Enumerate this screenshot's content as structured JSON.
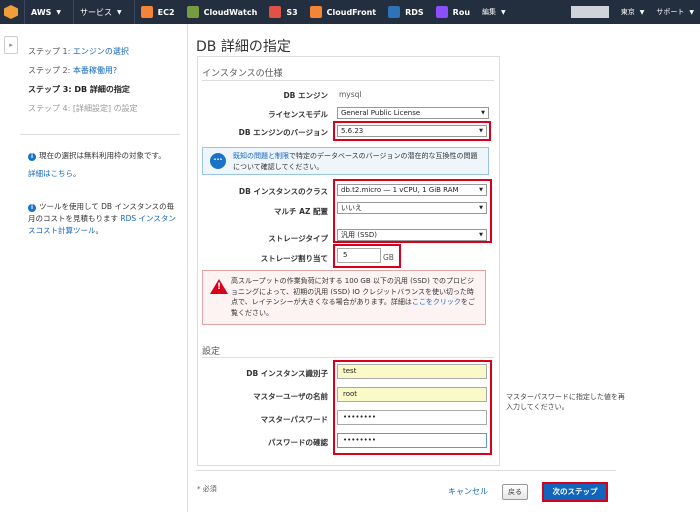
{
  "topbar": {
    "aws": "AWS",
    "services": "サービス",
    "services_ec2": "EC2",
    "services_cloudwatch": "CloudWatch",
    "services_s3": "S3",
    "services_cloudfront": "CloudFront",
    "services_rds": "RDS",
    "services_route": "Rou",
    "edit": "編集",
    "region": "東京",
    "support": "サポート",
    "colors": {
      "bg": "#232f3e",
      "ec2": "#f58536",
      "cw": "#759c3e",
      "s3": "#e05243",
      "cf": "#f58536",
      "rds": "#2e73b8",
      "route": "#8c4fff"
    }
  },
  "sidebar": {
    "steps": [
      {
        "prefix": "ステップ 1:",
        "label": "エンジンの選択"
      },
      {
        "prefix": "ステップ 2:",
        "label": "本番稼働用?"
      },
      {
        "prefix": "ステップ 3:",
        "label": "DB 詳細の指定"
      },
      {
        "prefix": "ステップ 4:",
        "label": "[詳細設定] の設定"
      }
    ],
    "info1": "現在の選択は無料利用枠の対象です。",
    "info1_link": "詳細はこちら",
    "info1_suffix": "。",
    "info2_a": "ツールを使用して DB インスタンスの毎月のコストを見積もります",
    "info2_link": "RDS インスタンスコスト計算ツール",
    "info2_suffix": "。"
  },
  "main": {
    "title": "DB 詳細の指定",
    "spec_section": "インスタンスの仕様",
    "engine_label": "DB エンジン",
    "engine_value": "mysql",
    "license_label": "ライセンスモデル",
    "license_value": "General Public License",
    "version_label": "DB エンジンのバージョン",
    "version_value": "5.6.23",
    "known_issue_link": "既知の問題と制限",
    "known_issue_text": "で特定のデータベースのバージョンの潜在的な互換性の問題について確認してください。",
    "class_label": "DB インスタンスのクラス",
    "class_value": "db.t2.micro — 1 vCPU, 1 GiB RAM",
    "multiaz_label": "マルチ AZ 配置",
    "multiaz_value": "いいえ",
    "storage_type_label": "ストレージタイプ",
    "storage_type_value": "汎用 (SSD)",
    "storage_label": "ストレージ割り当て",
    "storage_value": "5",
    "storage_unit": "GB",
    "warning_text": "高スループットの作業負荷に対する 100 GB 以下の汎用 (SSD) でのプロビジョニングによって、初期の汎用 (SSD) IO クレジットバランスを使い切った時点で、レイテンシーが大きくなる場合があります。詳細は",
    "warning_link": "ここをクリック",
    "warning_suffix": "をご覧ください。",
    "settings_section": "設定",
    "id_label": "DB インスタンス識別子",
    "id_value": "test",
    "master_user_label": "マスターユーザの名前",
    "master_user_value": "root",
    "master_pw_label": "マスターパスワード",
    "master_pw_value": "••••••••",
    "confirm_pw_label": "パスワードの確認",
    "confirm_pw_value": "••••••••",
    "hint": "マスターパスワードに指定した値を再入力してください。"
  },
  "footer": {
    "required_note": "* 必須",
    "cancel": "キャンセル",
    "back": "戻る",
    "next": "次のステップ"
  }
}
